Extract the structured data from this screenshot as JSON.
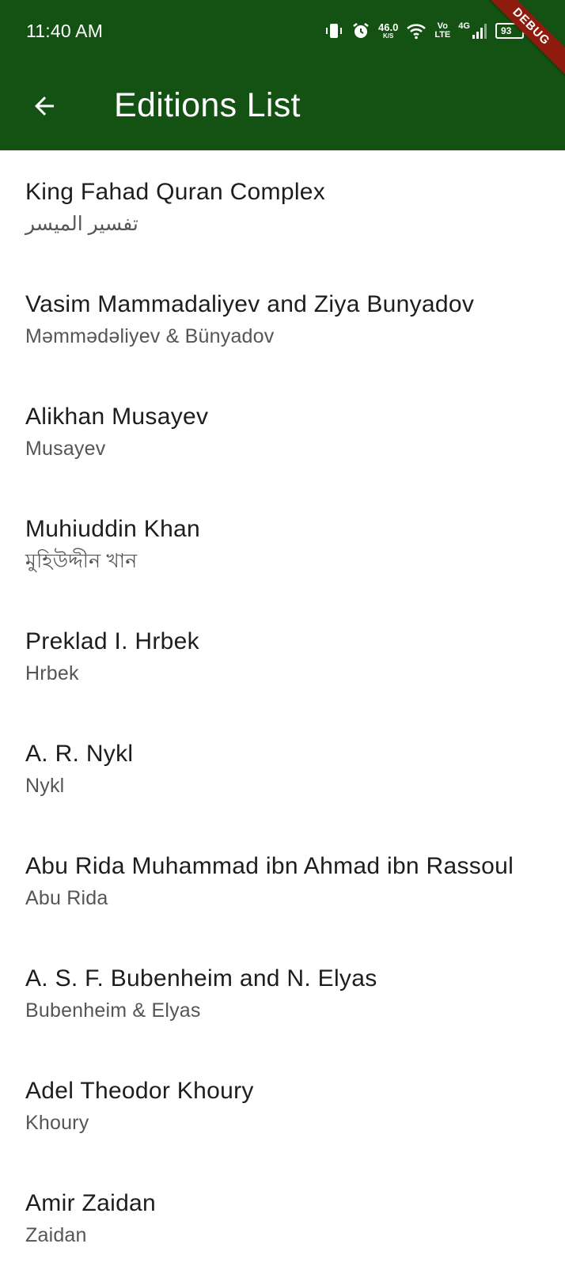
{
  "status_bar": {
    "time": "11:40 AM",
    "net_speed_value": "46.0",
    "net_speed_unit": "K/S",
    "volte_top": "Vo",
    "volte_bottom": "LTE",
    "network": "4G",
    "battery": "93",
    "debug_label": "DEBUG"
  },
  "header": {
    "title": "Editions List",
    "back_icon": "arrow-back-icon",
    "background_color": "#145214"
  },
  "editions": [
    {
      "name": "King Fahad Quran Complex",
      "short": "تفسير الميسر"
    },
    {
      "name": "Vasim Mammadaliyev and Ziya Bunyadov",
      "short": "Məmmədəliyev & Bünyadov"
    },
    {
      "name": "Alikhan Musayev",
      "short": "Musayev"
    },
    {
      "name": "Muhiuddin Khan",
      "short": "মুহিউদ্দীন খান"
    },
    {
      "name": "Preklad I. Hrbek",
      "short": "Hrbek"
    },
    {
      "name": "A. R. Nykl",
      "short": "Nykl"
    },
    {
      "name": "Abu Rida Muhammad ibn Ahmad ibn Rassoul",
      "short": "Abu Rida"
    },
    {
      "name": "A. S. F. Bubenheim and N. Elyas",
      "short": "Bubenheim & Elyas"
    },
    {
      "name": "Adel Theodor Khoury",
      "short": "Khoury"
    },
    {
      "name": "Amir Zaidan",
      "short": "Zaidan"
    }
  ]
}
